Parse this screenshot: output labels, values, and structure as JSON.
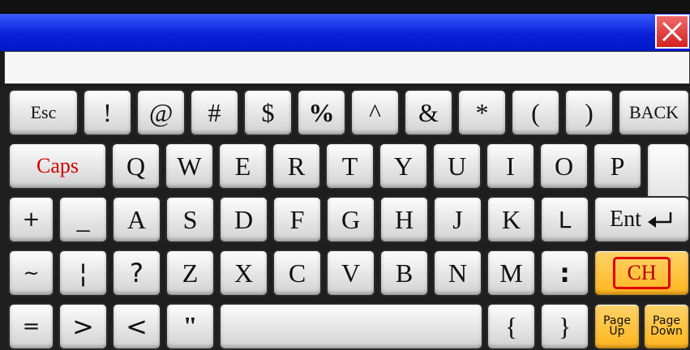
{
  "keyboard": {
    "row1": [
      "Esc",
      "!",
      "@",
      "#",
      "$",
      "%",
      "^",
      "&",
      "*",
      "(",
      ")",
      "BACK"
    ],
    "row2": [
      "Caps",
      "Q",
      "W",
      "E",
      "R",
      "T",
      "Y",
      "U",
      "I",
      "O",
      "P"
    ],
    "row3": [
      "+",
      "_",
      "A",
      "S",
      "D",
      "F",
      "G",
      "H",
      "J",
      "K",
      "L"
    ],
    "row4": [
      "~",
      "¦",
      "?",
      "Z",
      "X",
      "C",
      "V",
      "B",
      "N",
      "M",
      ":"
    ],
    "row5": [
      "=",
      ">",
      "<",
      "\"",
      "{",
      "}"
    ],
    "enter_label": "Ent",
    "ch_label": "CH",
    "page_up_label": "Page Up",
    "page_down_label": "Page Down"
  },
  "colors": {
    "titlebar": "#0a1fd8",
    "close_button": "#d42020",
    "caps_text": "#d40000",
    "ch_key": "#ffc44a"
  }
}
